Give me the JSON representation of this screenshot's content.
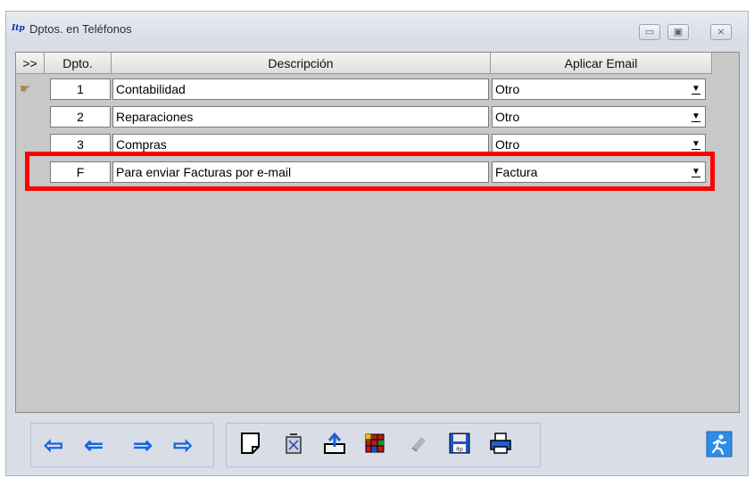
{
  "window": {
    "title": "Dptos. en Teléfonos",
    "app_icon": "Itp",
    "controls": {
      "minimize": "▭",
      "maximize": "▣",
      "close": "⨯"
    }
  },
  "grid": {
    "headers": {
      "selector": ">>",
      "dpto": "Dpto.",
      "descripcion": "Descripción",
      "email": "Aplicar Email"
    },
    "rows": [
      {
        "dpto": "1",
        "descripcion": "Contabilidad",
        "email": "Otro"
      },
      {
        "dpto": "2",
        "descripcion": "Reparaciones",
        "email": "Otro"
      },
      {
        "dpto": "3",
        "descripcion": "Compras",
        "email": "Otro"
      },
      {
        "dpto": "F",
        "descripcion": "Para enviar Facturas por e-mail",
        "email": "Factura"
      }
    ]
  },
  "icons": {
    "first": "⇦",
    "prev": "⇐",
    "next": "⇒",
    "last": "⇨",
    "dropdown": "▼",
    "pointer": "☛"
  },
  "colors": {
    "highlight": "#ff0000",
    "nav": "#1565e6"
  }
}
